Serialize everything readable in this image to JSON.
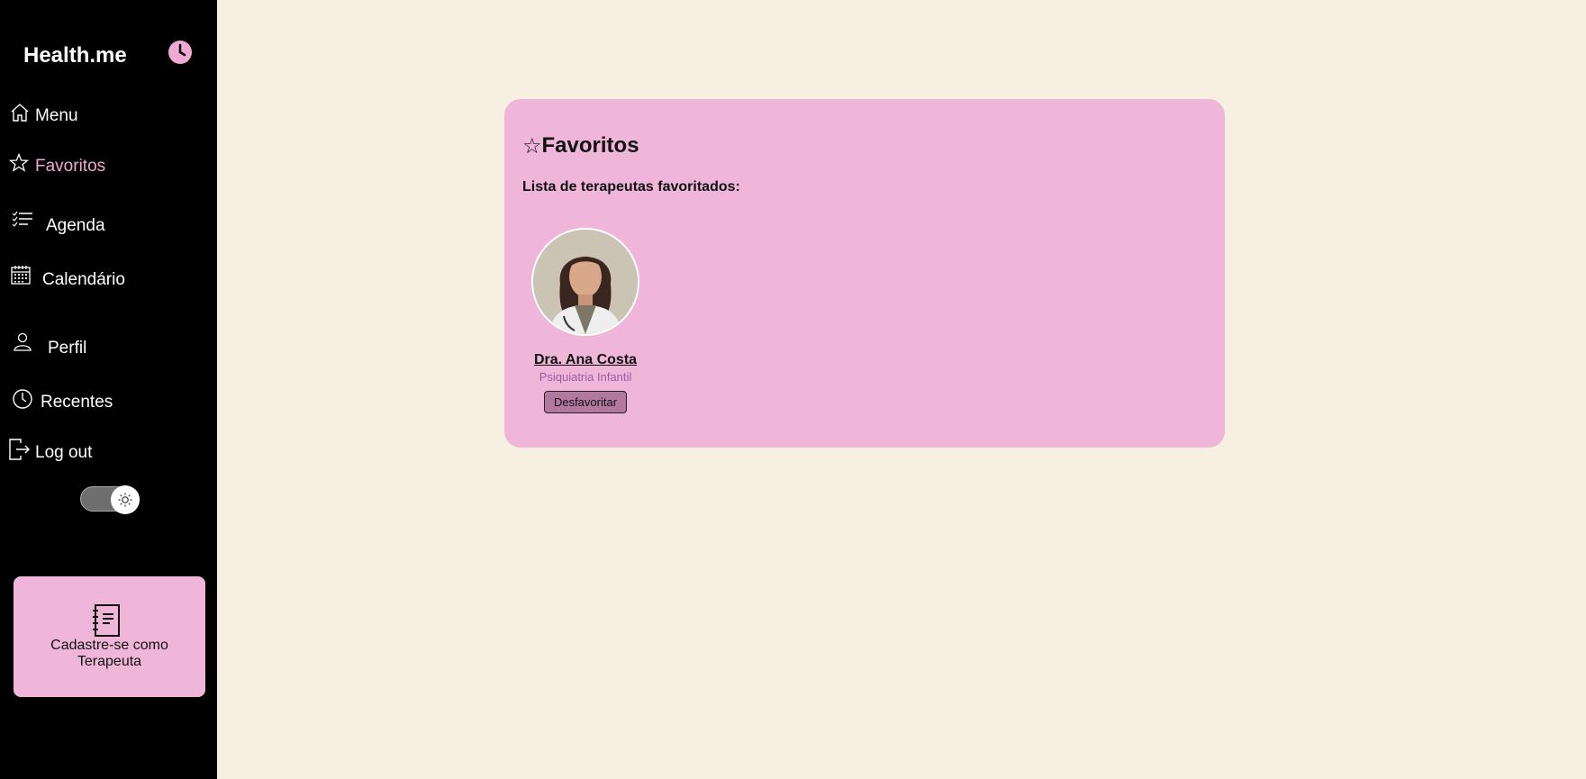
{
  "sidebar": {
    "brand": "Health.me",
    "items": [
      {
        "label": "Menu",
        "icon": "home-icon",
        "active": false
      },
      {
        "label": "Favoritos",
        "icon": "star-icon",
        "active": true
      },
      {
        "label": "Agenda",
        "icon": "list-icon",
        "active": false
      },
      {
        "label": "Calendário",
        "icon": "calendar-icon",
        "active": false
      },
      {
        "label": "Perfil",
        "icon": "user-icon",
        "active": false
      },
      {
        "label": "Recentes",
        "icon": "clock-icon",
        "active": false
      },
      {
        "label": "Log out",
        "icon": "logout-icon",
        "active": false
      }
    ],
    "theme_toggle_icon": "sun-icon",
    "register_card": {
      "label": "Cadastre-se como Terapeuta",
      "icon": "notebook-icon"
    }
  },
  "main": {
    "title_icon": "☆",
    "title": "Favoritos",
    "subtitle": "Lista de terapeutas favoritados:",
    "favorites": [
      {
        "name": "Dra. Ana Costa",
        "specialty": "Psiquiatria Infantil",
        "button_label": "Desfavoritar"
      }
    ]
  },
  "colors": {
    "accent": "#f0b6da",
    "background": "#f7efe2",
    "sidebar": "#000000",
    "active_nav": "#f0a8d4",
    "specialty": "#a05aa4",
    "button": "#b2789f"
  }
}
